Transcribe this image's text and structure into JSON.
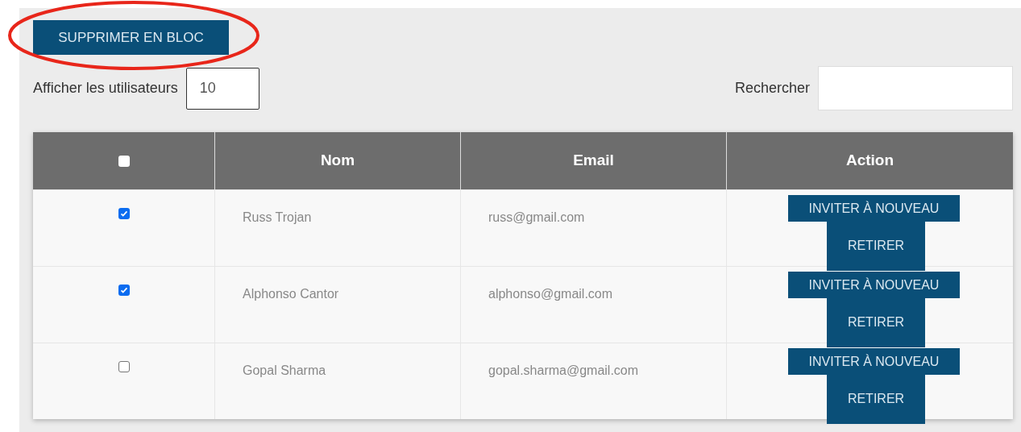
{
  "bulk_delete_button": "SUPPRIMER EN BLOC",
  "page_length": {
    "label": "Afficher les utilisateurs",
    "value": "10"
  },
  "search": {
    "label": "Rechercher"
  },
  "table": {
    "select_all": {
      "checked": false
    },
    "columns": [
      "Nom",
      "Email",
      "Action"
    ],
    "rows": [
      {
        "checked": true,
        "name": "Russ Trojan",
        "email": "russ@gmail.com",
        "actions": [
          "INVITER À NOUVEAU",
          "RETIRER"
        ]
      },
      {
        "checked": true,
        "name": "Alphonso Cantor",
        "email": "alphonso@gmail.com",
        "actions": [
          "INVITER À NOUVEAU",
          "RETIRER"
        ]
      },
      {
        "checked": false,
        "name": "Gopal Sharma",
        "email": "gopal.sharma@gmail.com",
        "actions": [
          "INVITER À NOUVEAU",
          "RETIRER"
        ]
      }
    ]
  }
}
